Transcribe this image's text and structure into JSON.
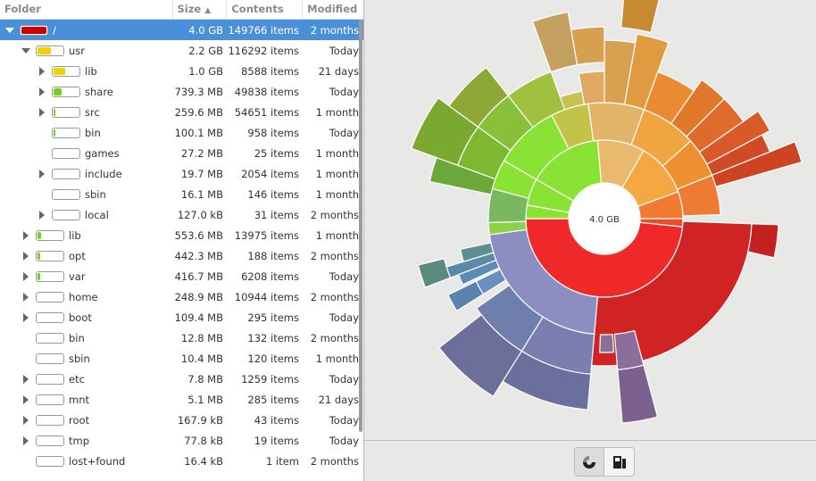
{
  "columns": {
    "folder": "Folder",
    "size": "Size",
    "contents": "Contents",
    "modified": "Modified"
  },
  "rows": [
    {
      "name": "/",
      "size": "4.0 GB",
      "contents": "149766 items",
      "modified": "2 months",
      "depth": 0,
      "expander": "open",
      "fill": 1.0,
      "color": "#cc0000",
      "selected": true
    },
    {
      "name": "usr",
      "size": "2.2 GB",
      "contents": "116292 items",
      "modified": "Today",
      "depth": 1,
      "expander": "open",
      "fill": 0.55,
      "color": "#edd400"
    },
    {
      "name": "lib",
      "size": "1.0 GB",
      "contents": "8588 items",
      "modified": "21 days",
      "depth": 2,
      "expander": "closed",
      "fill": 0.47,
      "color": "#edd400"
    },
    {
      "name": "share",
      "size": "739.3 MB",
      "contents": "49838 items",
      "modified": "Today",
      "depth": 2,
      "expander": "closed",
      "fill": 0.33,
      "color": "#73d216"
    },
    {
      "name": "src",
      "size": "259.6 MB",
      "contents": "54651 items",
      "modified": "1 month",
      "depth": 2,
      "expander": "closed",
      "fill": 0.08,
      "color": "#73d216"
    },
    {
      "name": "bin",
      "size": "100.1 MB",
      "contents": "958 items",
      "modified": "Today",
      "depth": 2,
      "expander": "none",
      "fill": 0.02,
      "color": "#73d216"
    },
    {
      "name": "games",
      "size": "27.2 MB",
      "contents": "25 items",
      "modified": "1 month",
      "depth": 2,
      "expander": "none",
      "fill": 0,
      "color": "#73d216"
    },
    {
      "name": "include",
      "size": "19.7 MB",
      "contents": "2054 items",
      "modified": "1 month",
      "depth": 2,
      "expander": "closed",
      "fill": 0,
      "color": "#73d216"
    },
    {
      "name": "sbin",
      "size": "16.1 MB",
      "contents": "146 items",
      "modified": "1 month",
      "depth": 2,
      "expander": "none",
      "fill": 0,
      "color": "#73d216"
    },
    {
      "name": "local",
      "size": "127.0 kB",
      "contents": "31 items",
      "modified": "2 months",
      "depth": 2,
      "expander": "closed",
      "fill": 0,
      "color": "#73d216"
    },
    {
      "name": "lib",
      "size": "553.6 MB",
      "contents": "13975 items",
      "modified": "1 month",
      "depth": 1,
      "expander": "closed",
      "fill": 0.14,
      "color": "#73d216"
    },
    {
      "name": "opt",
      "size": "442.3 MB",
      "contents": "188 items",
      "modified": "2 months",
      "depth": 1,
      "expander": "closed",
      "fill": 0.11,
      "color": "#73d216"
    },
    {
      "name": "var",
      "size": "416.7 MB",
      "contents": "6208 items",
      "modified": "Today",
      "depth": 1,
      "expander": "closed",
      "fill": 0.1,
      "color": "#73d216"
    },
    {
      "name": "home",
      "size": "248.9 MB",
      "contents": "10944 items",
      "modified": "2 months",
      "depth": 1,
      "expander": "closed",
      "fill": 0,
      "color": "#73d216"
    },
    {
      "name": "boot",
      "size": "109.4 MB",
      "contents": "295 items",
      "modified": "Today",
      "depth": 1,
      "expander": "closed",
      "fill": 0,
      "color": "#73d216"
    },
    {
      "name": "bin",
      "size": "12.8 MB",
      "contents": "132 items",
      "modified": "2 months",
      "depth": 1,
      "expander": "none",
      "fill": 0,
      "color": "#73d216"
    },
    {
      "name": "sbin",
      "size": "10.4 MB",
      "contents": "120 items",
      "modified": "1 month",
      "depth": 1,
      "expander": "none",
      "fill": 0,
      "color": "#73d216"
    },
    {
      "name": "etc",
      "size": "7.8 MB",
      "contents": "1259 items",
      "modified": "Today",
      "depth": 1,
      "expander": "closed",
      "fill": 0,
      "color": "#73d216"
    },
    {
      "name": "mnt",
      "size": "5.1 MB",
      "contents": "285 items",
      "modified": "21 days",
      "depth": 1,
      "expander": "closed",
      "fill": 0,
      "color": "#73d216"
    },
    {
      "name": "root",
      "size": "167.9 kB",
      "contents": "43 items",
      "modified": "Today",
      "depth": 1,
      "expander": "closed",
      "fill": 0,
      "color": "#73d216"
    },
    {
      "name": "tmp",
      "size": "77.8 kB",
      "contents": "19 items",
      "modified": "Today",
      "depth": 1,
      "expander": "closed",
      "fill": 0,
      "color": "#73d216"
    },
    {
      "name": "lost+found",
      "size": "16.4 kB",
      "contents": "1 item",
      "modified": "2 months",
      "depth": 1,
      "expander": "none",
      "fill": 0,
      "color": "#73d216"
    }
  ],
  "chart": {
    "center_label": "4.0 GB"
  },
  "toolbar": {
    "ring_chart_icon": "ring-chart-icon",
    "treemap_icon": "treemap-chart-icon"
  }
}
